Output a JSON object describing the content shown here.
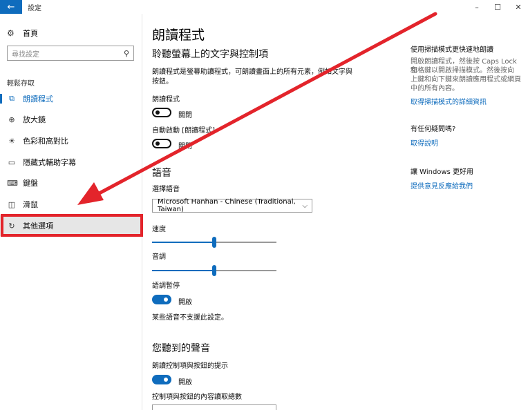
{
  "window": {
    "title": "設定",
    "minimize": "–",
    "maximize": "☐",
    "close": "✕",
    "back": "←"
  },
  "sidebar": {
    "home": "首頁",
    "search_placeholder": "尋找設定",
    "section": "輕鬆存取",
    "items": [
      {
        "label": "朗讀程式",
        "icon": "narrator-icon",
        "glyph": "⧉"
      },
      {
        "label": "放大鏡",
        "icon": "magnifier-icon",
        "glyph": "⊕"
      },
      {
        "label": "色彩和高對比",
        "icon": "brightness-icon",
        "glyph": "☀"
      },
      {
        "label": "隱藏式輔助字幕",
        "icon": "captions-icon",
        "glyph": "▭"
      },
      {
        "label": "鍵盤",
        "icon": "keyboard-icon",
        "glyph": "⌨"
      },
      {
        "label": "滑鼠",
        "icon": "mouse-icon",
        "glyph": "◫"
      },
      {
        "label": "其他選項",
        "icon": "other-options-icon",
        "glyph": "↻"
      }
    ]
  },
  "main": {
    "title": "朗讀程式",
    "section1": "聆聽螢幕上的文字與控制項",
    "desc_line1": "朗讀程式是螢幕助讀程式，可朗讀畫面上的所有元素，例如文字與",
    "desc_line2": "按鈕。",
    "narrator_label": "朗讀程式",
    "narrator_state": "關閉",
    "autostart_label": "自動啟動 [朗讀程式]",
    "autostart_state": "關閉",
    "voice_section": "語音",
    "choose_voice": "選擇語音",
    "voice_value": "Microsoft Hanhan - Chinese (Traditional, Taiwan)",
    "speed_label": "速度",
    "speed_value": 50,
    "pitch_label": "音調",
    "pitch_value": 50,
    "pause_label": "語調暫停",
    "pause_state": "開啟",
    "note": "某些語音不支援此設定。",
    "sounds_section": "您聽到的聲音",
    "hints_label": "朗讀控制項與按鈕的提示",
    "hints_state": "開啟",
    "context_label": "控制項與按鈕的內容讀取總數"
  },
  "right": {
    "scan_title": "使用掃描模式更快速地朗讀",
    "scan_body_1": "開啟朗讀程式，然後按 Caps Lock 和",
    "scan_body_2": "空格鍵以開啟掃描模式。然後按向",
    "scan_body_3": "上鍵和向下鍵來朗讀應用程式或網頁",
    "scan_body_4": "中的所有內容。",
    "scan_link": "取得掃描模式的詳細資訊",
    "question": "有任何疑問嗎?",
    "help_link": "取得說明",
    "improve": "讓 Windows 更好用",
    "feedback_link": "提供意見反應給我們"
  },
  "colors": {
    "accent": "#0f6cbd",
    "highlight_box": "#e3242b",
    "arrow": "#e3242b"
  }
}
